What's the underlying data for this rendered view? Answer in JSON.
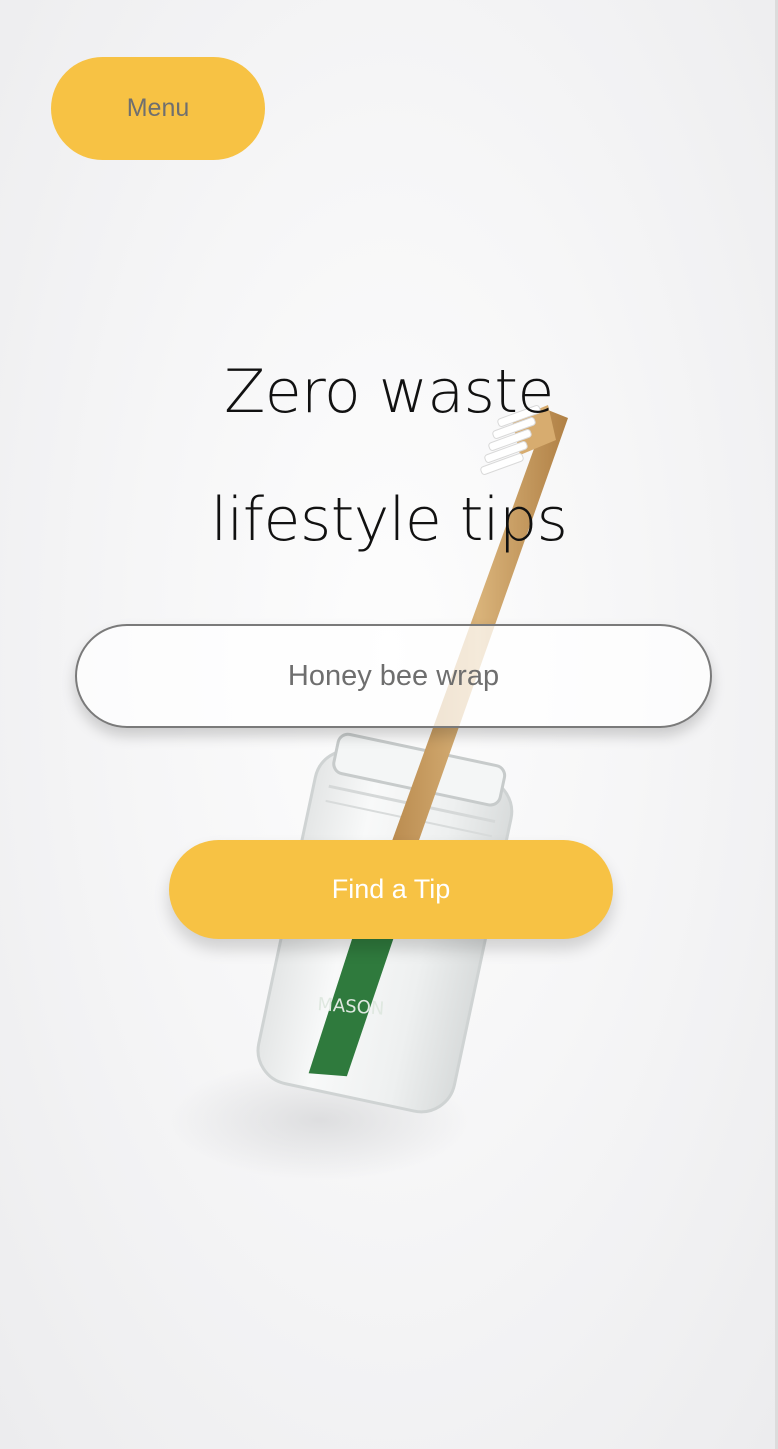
{
  "header": {
    "menu_label": "Menu"
  },
  "hero": {
    "title_line1": "Zero waste",
    "title_line2": "lifestyle tips",
    "image_icon": "toothbrush-in-mason-jar"
  },
  "search": {
    "placeholder": "Honey bee wrap",
    "value": ""
  },
  "actions": {
    "find_label": "Find a Tip"
  },
  "colors": {
    "accent": "#f7c244",
    "background": "#f2f2f4",
    "title_text": "#111111",
    "button_text": "#ffffff",
    "muted_text": "#6e6e6e"
  }
}
